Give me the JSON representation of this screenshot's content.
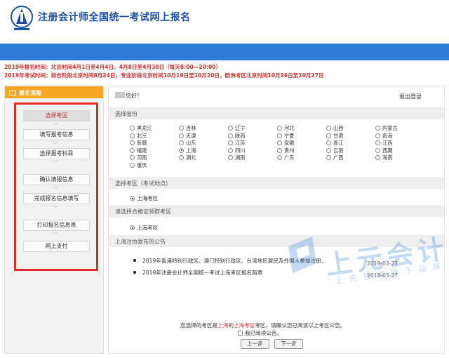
{
  "header": {
    "title": "注册会计师全国统一考试网上报名"
  },
  "notices": [
    "2019年报名时间：北京时间4月1日至4月4日、4月8日至4月30日（每天8:00—20:00）",
    "2019年考试时间：综合阶段北京时间8月24日，专业阶段北京时间10月19日至10月20日，欧洲考区北京时间10月26日至10月27日"
  ],
  "sidebar": {
    "title": "报名流程",
    "steps": [
      "选择考区",
      "填写报考信息",
      "选择报考科目",
      "确认填报信息",
      "完成报名信息填写",
      "打印报名信息表",
      "网上支付"
    ]
  },
  "main": {
    "greeting": "您好！",
    "logout": "退出登录",
    "province_header": "选择省份",
    "provinces": [
      "黑龙江",
      "吉林",
      "辽宁",
      "河北",
      "山西",
      "内蒙古",
      "北京",
      "天津",
      "陕西",
      "宁夏",
      "甘肃",
      "青海",
      "新疆",
      "山东",
      "江苏",
      "安徽",
      "浙江",
      "江西",
      "福建",
      "上海",
      "四川",
      "贵州",
      "云南",
      "西藏",
      "河南",
      "湖北",
      "湖南",
      "广东",
      "广西",
      "海南",
      "重庆"
    ],
    "selected_province": "上海",
    "area_header": "选择考区（考试地点）",
    "area_option": "上海考区",
    "cert_header": "请选择合格证领取考区",
    "cert_option": "上海考区",
    "announce_header": "上海注协发布的公告",
    "announcements": [
      {
        "title": "2019年香港特别行政区、澳门特别行政区、台湾地区居民及外国人参加注册...",
        "date": "2019-03-27"
      },
      {
        "title": "2019年注册会计师全国统一考试上海考区报名简章",
        "date": "2019-03-27"
      }
    ],
    "confirm": {
      "part1": "您选择的考区是",
      "province": "上海",
      "part2": "的",
      "area": "上海考区",
      "part3": "考区，请确认您已阅读以上考区公告。"
    },
    "agree_label": "我已阅读公告。",
    "prev_button": "上一步",
    "next_button": "下一步"
  },
  "watermark": {
    "main": "上元会计",
    "sub": "上元教育旗下品牌"
  },
  "colors": {
    "brand_blue": "#2f7ad6",
    "accent_orange": "#f5a623",
    "alert_red": "#d0312d",
    "frame_red": "#e52a2a"
  }
}
